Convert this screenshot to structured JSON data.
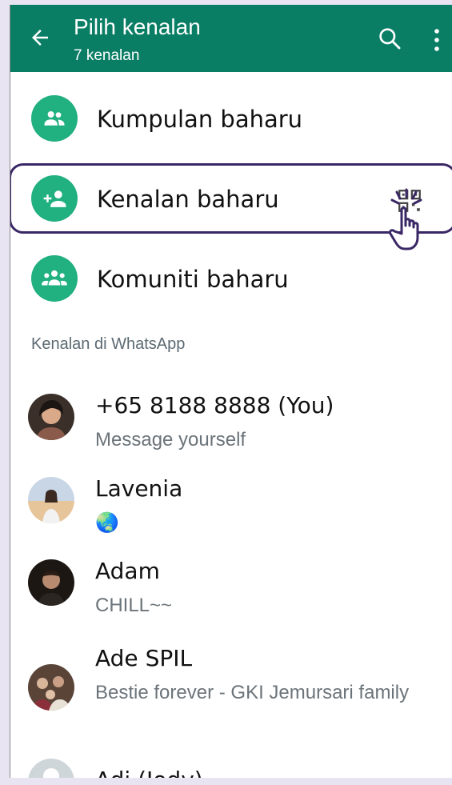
{
  "header": {
    "title": "Pilih kenalan",
    "subtitle": "7 kenalan"
  },
  "actions": [
    {
      "label": "Kumpulan baharu",
      "icon": "group-icon"
    },
    {
      "label": "Kenalan baharu",
      "icon": "add-person-icon"
    },
    {
      "label": "Komuniti baharu",
      "icon": "community-icon"
    }
  ],
  "section_header": "Kenalan di WhatsApp",
  "contacts": [
    {
      "name": "+65 8188 8888 (You)",
      "status": "Message yourself"
    },
    {
      "name": "Lavenia",
      "status": "🌏"
    },
    {
      "name": "Adam",
      "status": "CHILL~~"
    },
    {
      "name": "Ade SPIL",
      "status": "Bestie forever - GKI Jemursari family"
    },
    {
      "name": "Adi (Jody)",
      "status": ""
    }
  ],
  "colors": {
    "appbar": "#0a7e65",
    "accent": "#21b07f",
    "highlight": "#3a2766"
  }
}
